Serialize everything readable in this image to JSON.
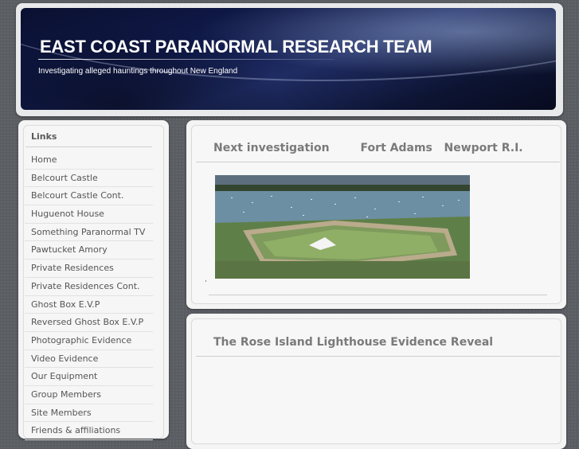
{
  "header": {
    "title": "EAST COAST PARANORMAL RESEARCH TEAM",
    "tagline": "Investigating alleged hauntings throughout New England"
  },
  "sidebar": {
    "heading": "Links",
    "items": [
      {
        "label": "Home"
      },
      {
        "label": "Belcourt Castle"
      },
      {
        "label": "Belcourt Castle Cont."
      },
      {
        "label": "Huguenot House"
      },
      {
        "label": "Something Paranormal TV"
      },
      {
        "label": "Pawtucket Amory"
      },
      {
        "label": "Private Residences"
      },
      {
        "label": "Private Residences Cont."
      },
      {
        "label": "Ghost Box E.V.P"
      },
      {
        "label": "Reversed Ghost Box E.V.P"
      },
      {
        "label": "Photographic Evidence"
      },
      {
        "label": "Video Evidence"
      },
      {
        "label": "Our Equipment"
      },
      {
        "label": "Group Members"
      },
      {
        "label": "Site Members"
      },
      {
        "label": "Friends & affiliations"
      }
    ]
  },
  "posts": [
    {
      "title": "Next investigation        Fort Adams   Newport R.I."
    },
    {
      "title": "The Rose Island Lighthouse Evidence Reveal"
    }
  ]
}
